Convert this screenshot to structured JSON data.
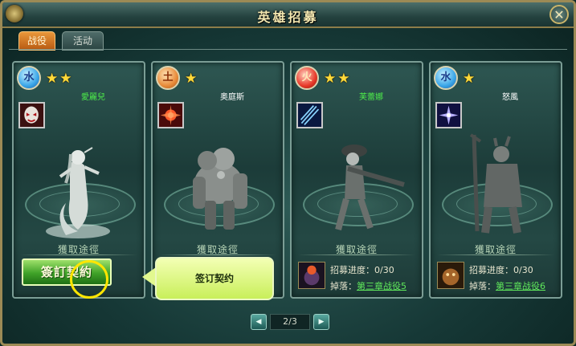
{
  "window": {
    "title": "英雄招募",
    "close_glyph": "✕"
  },
  "tabs": [
    {
      "label": "战役",
      "active": true
    },
    {
      "label": "活动",
      "active": false
    }
  ],
  "heroes": [
    {
      "element": "水",
      "element_type": "water",
      "stars": 2,
      "name": "愛麗兒",
      "name_color": "#4ef04a",
      "skill_icon": "demon-mask-icon",
      "obtain_title": "獲取途徑",
      "action": "contract"
    },
    {
      "element": "土",
      "element_type": "earth",
      "stars": 1,
      "name": "奥庭斯",
      "name_color": "#ffffff",
      "skill_icon": "burst-icon",
      "obtain_title": "獲取途徑",
      "action": "tooltip"
    },
    {
      "element": "火",
      "element_type": "fire",
      "stars": 2,
      "name": "芙蕾娜",
      "name_color": "#4ef04a",
      "skill_icon": "claw-slash-icon",
      "obtain_title": "獲取途徑",
      "action": "info",
      "info": {
        "progress_label": "招募进度：",
        "progress_value": "0/30",
        "drop_label": "掉落：",
        "drop_link": "第三章战役5",
        "drop_icon": "fire-character-portrait-icon"
      }
    },
    {
      "element": "水",
      "element_type": "water",
      "stars": 1,
      "name": "怒風",
      "name_color": "#ffffff",
      "skill_icon": "star-burst-icon",
      "obtain_title": "獲取途徑",
      "action": "info",
      "info": {
        "progress_label": "招募进度：",
        "progress_value": "0/30",
        "drop_label": "掉落：",
        "drop_link": "第三章战役6",
        "drop_icon": "water-beast-portrait-icon"
      }
    }
  ],
  "contract_button": {
    "label": "簽訂契約"
  },
  "tooltip": {
    "text": "签订契约"
  },
  "pager": {
    "label": "2/3",
    "prev_icon": "arrow-left-icon",
    "next_icon": "arrow-right-icon"
  },
  "colors": {
    "frame_gold": "#9c8a55",
    "panel_teal": "#2e5752",
    "link_green": "#5fe85b",
    "tab_active": "#e9973a"
  }
}
